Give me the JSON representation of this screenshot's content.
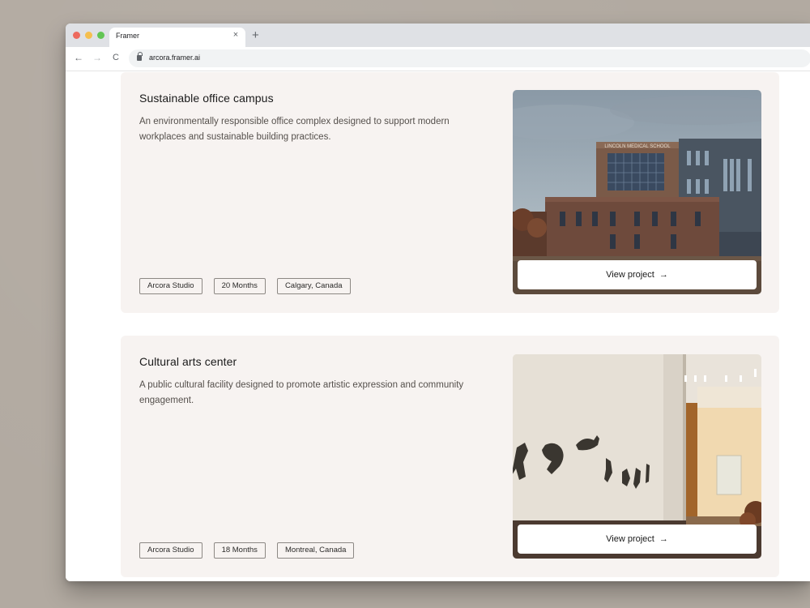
{
  "browser": {
    "tab_title": "Framer",
    "tab_close": "×",
    "new_tab": "+",
    "back": "←",
    "forward": "→",
    "reload": "C",
    "url": "arcora.framer.ai"
  },
  "projects": [
    {
      "title": "Sustainable office campus",
      "description": "An environmentally responsible office complex designed to support modern workplaces and sustainable building practices.",
      "tags": [
        "Arcora Studio",
        "20 Months",
        "Calgary, Canada"
      ],
      "image_sign": "LINCOLN MEDICAL SCHOOL",
      "button_label": "View project",
      "button_arrow": "→"
    },
    {
      "title": "Cultural arts center",
      "description": "A public cultural facility designed to promote artistic expression and community engagement.",
      "tags": [
        "Arcora Studio",
        "18 Months",
        "Montreal, Canada"
      ],
      "button_label": "View project",
      "button_arrow": "→"
    }
  ]
}
